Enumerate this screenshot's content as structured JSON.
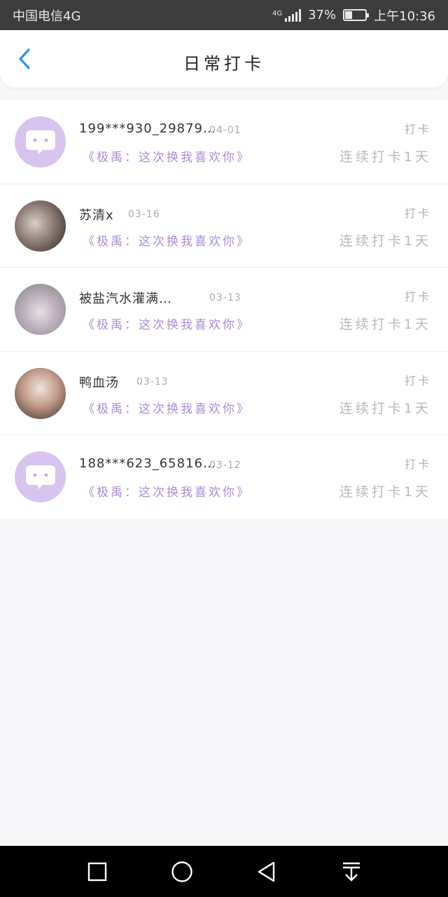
{
  "status_bar": {
    "carrier": "中国电信4G",
    "network": "4G",
    "battery": "37%",
    "battery_level": 0.37,
    "time": "上午10:36"
  },
  "header": {
    "title": "日常打卡"
  },
  "entries": [
    {
      "name": "199***930_29879…",
      "date": "04-01",
      "quote": "《极禹：这次换我喜欢你》",
      "tag": "打卡",
      "streak": "连续打卡1天",
      "avatar": "default-chat-avatar"
    },
    {
      "name": "苏清x",
      "date": "03-16",
      "quote": "《极禹：这次换我喜欢你》",
      "tag": "打卡",
      "streak": "连续打卡1天",
      "avatar": "photo"
    },
    {
      "name": "被盐汽水灌满…",
      "date": "03-13",
      "quote": "《极禹：这次换我喜欢你》",
      "tag": "打卡",
      "streak": "连续打卡1天",
      "avatar": "photo"
    },
    {
      "name": "鸭血汤",
      "date": "03-13",
      "quote": "《极禹：这次换我喜欢你》",
      "tag": "打卡",
      "streak": "连续打卡1天",
      "avatar": "photo"
    },
    {
      "name": "188***623_65816…",
      "date": "03-12",
      "quote": "《极禹：这次换我喜欢你》",
      "tag": "打卡",
      "streak": "连续打卡1天",
      "avatar": "default-chat-avatar"
    }
  ],
  "colors": {
    "accent_blue": "#2f8ff0",
    "quote_purple": "#a98bd6",
    "avatar_default": "#d9c4f0"
  }
}
